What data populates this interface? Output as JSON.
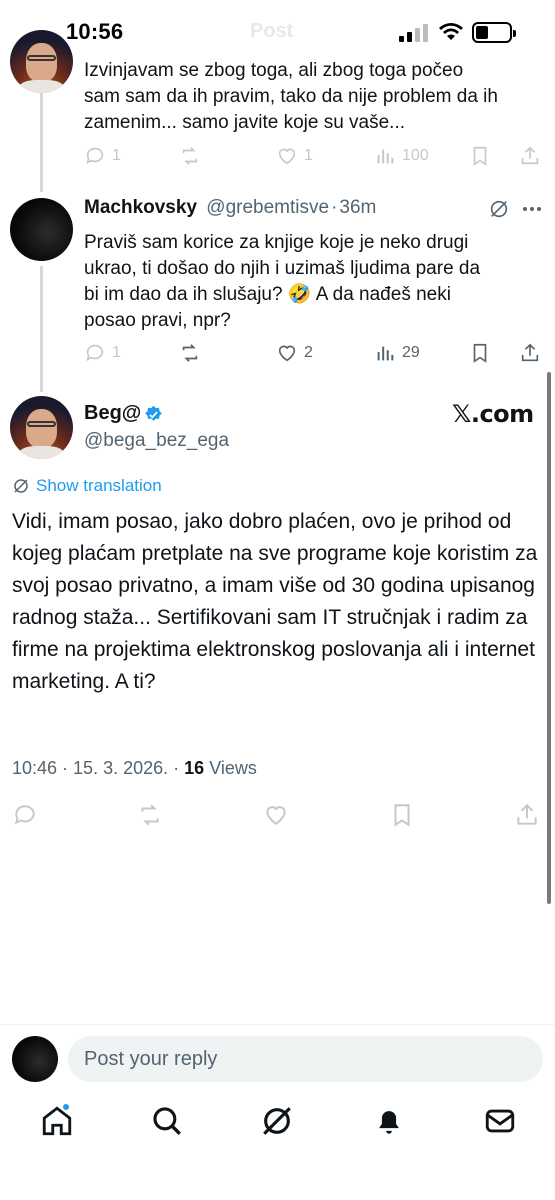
{
  "status_bar": {
    "time": "10:56",
    "background_title": "Post"
  },
  "previous_reply": {
    "text": "Izvinjavam se zbog toga, ali zbog toga počeo\nsam sam da ih pravim, tako da nije problem da ih\nzamenim... samo javite koje su vaše...",
    "reply_count": "1",
    "like_count": "1",
    "view_count": "100"
  },
  "reply": {
    "name": "Machkovsky",
    "handle": "@grebemtisve",
    "separator": "·",
    "time": "36m",
    "text": "Praviš sam korice za knjige koje je neko drugi\nukrao, ti došao do njih i uzimaš ljudima pare da\nbi im dao da ih slušaju? 🤣 A da nađeš neki\nposao pravi, npr?",
    "reply_count": "1",
    "like_count": "2",
    "view_count": "29",
    "avatar_icon": "dark-avatar"
  },
  "main_post": {
    "name": "Beg@",
    "handle": "@bega_bez_ega",
    "verified_icon": "verified-badge-icon",
    "watermark": "𝕏.com",
    "translate_label": "Show translation",
    "text": "Vidi, imam posao, jako dobro plaćen, ovo je prihod od kojeg plaćam pretplate na sve programe koje koristim za svoj posao privatno, a imam više od 30 godina upisanog radnog staža... Sertifikovani sam IT stručnjak i radim za firme na projektima elektronskog poslovanja ali i internet marketing. A ti?",
    "time": "10:46",
    "date": "15. 3. 2026.",
    "views_count": "16",
    "views_label": "Views"
  },
  "reply_composer": {
    "placeholder": "Post your reply"
  },
  "colors": {
    "accent": "#1d9bf0",
    "muted": "#536471",
    "text": "#0f1419",
    "line": "#cfd9de"
  },
  "tab_bar": [
    "home-icon",
    "search-icon",
    "grok-icon",
    "notifications-icon",
    "messages-icon"
  ]
}
